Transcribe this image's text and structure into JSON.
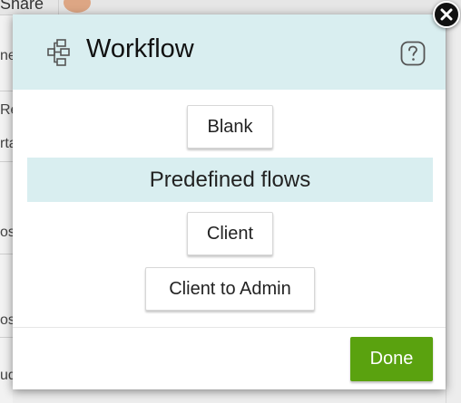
{
  "background": {
    "share_label": "Share",
    "fragments": [
      "ne",
      "Res",
      "rta",
      "os",
      "os",
      "ude"
    ]
  },
  "modal": {
    "title": "Workflow",
    "title_icon": "workflow-icon",
    "help_icon": "help-question-icon",
    "close_icon": "close-icon",
    "blank_button": "Blank",
    "section_heading": "Predefined flows",
    "predefined_flows": [
      "Client",
      "Client to Admin"
    ],
    "done_button": "Done"
  },
  "colors": {
    "header_bg": "#d9eef0",
    "done_bg": "#5aa20f"
  }
}
